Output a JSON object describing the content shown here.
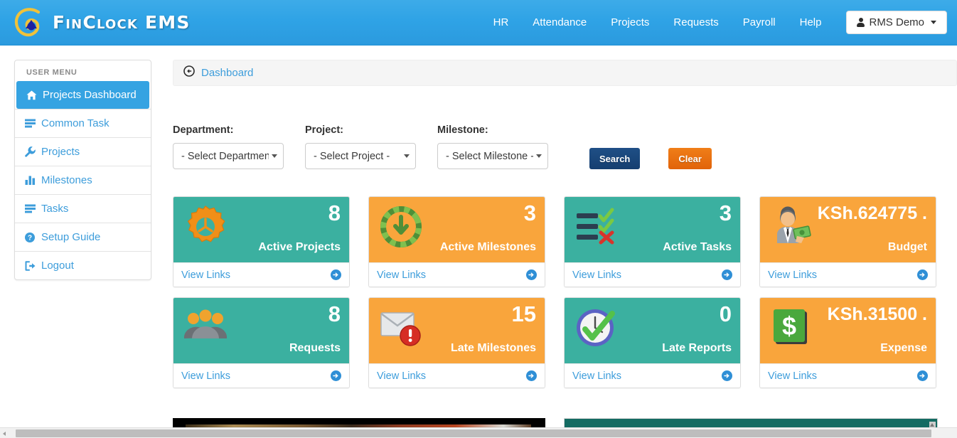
{
  "header": {
    "brand": "FinClock EMS",
    "logo_icon": "spiral-logo-icon",
    "nav": [
      {
        "label": "HR",
        "name": "nav-hr"
      },
      {
        "label": "Attendance",
        "name": "nav-attendance"
      },
      {
        "label": "Projects",
        "name": "nav-projects"
      },
      {
        "label": "Requests",
        "name": "nav-requests"
      },
      {
        "label": "Payroll",
        "name": "nav-payroll"
      },
      {
        "label": "Help",
        "name": "nav-help"
      }
    ],
    "user": {
      "label": "RMS Demo",
      "icon": "user-icon",
      "caret": "caret-down-icon"
    },
    "bg_color": "#2fa3e6"
  },
  "sidebar": {
    "title": "USER MENU",
    "items": [
      {
        "label": "Projects Dashboard",
        "icon": "home-icon",
        "active": true
      },
      {
        "label": "Common Task",
        "icon": "list-lines-icon",
        "active": false
      },
      {
        "label": "Projects",
        "icon": "wrench-icon",
        "active": false
      },
      {
        "label": "Milestones",
        "icon": "bar-chart-icon",
        "active": false
      },
      {
        "label": "Tasks",
        "icon": "list-lines-icon",
        "active": false
      },
      {
        "label": "Setup Guide",
        "icon": "question-circle-icon",
        "active": false
      },
      {
        "label": "Logout",
        "icon": "sign-out-icon",
        "active": false
      }
    ],
    "active_color": "#35a3e2",
    "link_color": "#3d9ddb"
  },
  "breadcrumb": {
    "icon": "dashboard-circle-icon",
    "label": "Dashboard"
  },
  "filters": {
    "department": {
      "label": "Department:",
      "value": "- Select Department -"
    },
    "project": {
      "label": "Project:",
      "value": "- Select Project -"
    },
    "milestone": {
      "label": "Milestone:",
      "value": "- Select Milestone -"
    },
    "search_button": "Search",
    "clear_button": "Clear",
    "search_color": "#1a4478",
    "clear_color": "#e8690e"
  },
  "cards": {
    "view_links_label": "View Links",
    "teal_color": "#3bb0a0",
    "orange_color": "#f9a53c",
    "row1": [
      {
        "value": "8",
        "label": "Active Projects",
        "icon": "gear-icon",
        "color": "teal",
        "money": false
      },
      {
        "value": "3",
        "label": "Active Milestones",
        "icon": "clock-download-icon",
        "color": "orange",
        "money": false
      },
      {
        "value": "3",
        "label": "Active Tasks",
        "icon": "checklist-icon",
        "color": "teal",
        "money": false
      },
      {
        "value": "KSh.624775 .",
        "label": "Budget",
        "icon": "businessman-money-icon",
        "color": "orange",
        "money": true
      }
    ],
    "row2": [
      {
        "value": "8",
        "label": "Requests",
        "icon": "group-people-icon",
        "color": "teal",
        "money": false
      },
      {
        "value": "15",
        "label": "Late Milestones",
        "icon": "mail-alert-icon",
        "color": "orange",
        "money": false
      },
      {
        "value": "0",
        "label": "Late Reports",
        "icon": "clock-check-icon",
        "color": "teal",
        "money": false
      },
      {
        "value": "KSh.31500 .",
        "label": "Expense",
        "icon": "dollar-sign-icon",
        "color": "orange",
        "money": true
      }
    ]
  },
  "bottom": {
    "video_panel": "video-preview-panel",
    "teal_panel": "teal-content-panel"
  }
}
